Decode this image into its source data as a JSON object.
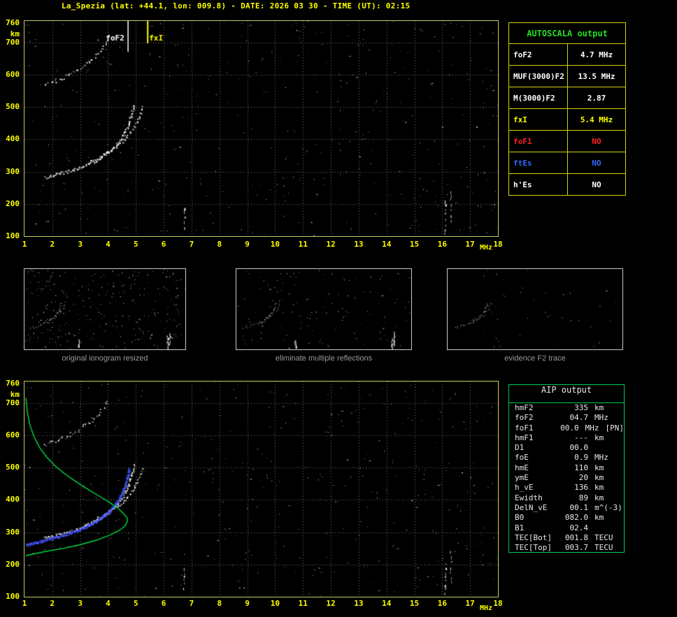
{
  "header": {
    "title": "La_Spezia (lat: +44.1, lon: 009.8) - DATE: 2026 03 30 - TIME (UT): 02:15"
  },
  "colors": {
    "background": "#000000",
    "title": "#ffff00",
    "axis": "#ffff00",
    "plot_border": "#c8c860",
    "grid": "#7a7a7a",
    "echo": "#ffffff",
    "profile_green": "#00dd44",
    "model_blue": "#4455ff",
    "autoscala_border": "#d4d400",
    "autoscala_title": "#22dd22",
    "aip_border": "#00cc55",
    "aip_text": "#e8e8e8",
    "caption": "#9a9a9a"
  },
  "autoscala_table": {
    "title": "AUTOSCALA output",
    "rows": [
      {
        "label": "foF2",
        "value": "4.7 MHz",
        "color": "#ffffff"
      },
      {
        "label": "MUF(3000)F2",
        "value": "13.5 MHz",
        "color": "#ffffff"
      },
      {
        "label": "M(3000)F2",
        "value": "2.87",
        "color": "#ffffff"
      },
      {
        "label": "fxI",
        "value": "5.4 MHz",
        "color": "#ffff00"
      },
      {
        "label": "foF1",
        "value": "NO",
        "color": "#ff2222"
      },
      {
        "label": "ftEs",
        "value": "NO",
        "color": "#3366ff"
      },
      {
        "label": "h'Es",
        "value": "NO",
        "color": "#ffffff"
      }
    ]
  },
  "aip_table": {
    "title": "AIP output",
    "rows": [
      {
        "label": "hmF2",
        "value": "335",
        "unit": "km",
        "note": ""
      },
      {
        "label": "foF2",
        "value": "04.7",
        "unit": "MHz",
        "note": ""
      },
      {
        "label": "foF1",
        "value": "00.0",
        "unit": "MHz",
        "note": "[PN]"
      },
      {
        "label": "hmF1",
        "value": "---",
        "unit": "km",
        "note": ""
      },
      {
        "label": "D1",
        "value": "00.0",
        "unit": "",
        "note": ""
      },
      {
        "label": "foE",
        "value": "0.9",
        "unit": "MHz",
        "note": ""
      },
      {
        "label": "hmE",
        "value": "110",
        "unit": "km",
        "note": ""
      },
      {
        "label": "ymE",
        "value": "20",
        "unit": "km",
        "note": ""
      },
      {
        "label": "h_vE",
        "value": "136",
        "unit": "km",
        "note": ""
      },
      {
        "label": "Ewidth",
        "value": "89",
        "unit": "km",
        "note": ""
      },
      {
        "label": "DelN_vE",
        "value": "00.1",
        "unit": "m^(-3)",
        "note": ""
      },
      {
        "label": "B0",
        "value": "082.0",
        "unit": "km",
        "note": ""
      },
      {
        "label": "B1",
        "value": "02.4",
        "unit": "",
        "note": ""
      },
      {
        "label": "TEC[Bot]",
        "value": "001.8",
        "unit": "TECU",
        "note": ""
      },
      {
        "label": "TEC[Top]",
        "value": "003.7",
        "unit": "TECU",
        "note": ""
      }
    ]
  },
  "thumbnails": [
    {
      "caption": "original ionogram resized"
    },
    {
      "caption": "eliminate multiple reflections"
    },
    {
      "caption": "evidence F2 trace"
    }
  ],
  "chart_data": {
    "type": "scatter",
    "title": "Ionogram La_Spezia 2026-03-30 02:15 UT",
    "x_axis": {
      "label": "MHz",
      "range": [
        1,
        18
      ],
      "ticks": [
        1,
        2,
        3,
        4,
        5,
        6,
        7,
        8,
        9,
        10,
        11,
        12,
        13,
        14,
        15,
        16,
        17,
        18
      ]
    },
    "y_axis": {
      "label": "km",
      "range": [
        100,
        766
      ],
      "ticks": [
        760,
        700,
        600,
        500,
        400,
        300,
        200,
        100
      ],
      "grid_ticks": [
        200,
        300,
        400,
        500,
        600,
        700
      ]
    },
    "grid": true,
    "annotations": [
      {
        "id": "foF2",
        "label": "foF2",
        "mhz": 4.7,
        "color": "#ffffff",
        "line_height": 44,
        "label_dx": -31,
        "label_dy": 28
      },
      {
        "id": "fxI",
        "label": "fxI",
        "mhz": 5.4,
        "color": "#ffff00",
        "line_height": 32,
        "label_dx": 3,
        "label_dy": 28
      }
    ],
    "traces": {
      "o_trace": [
        [
          1.7,
          283
        ],
        [
          2.0,
          289
        ],
        [
          2.3,
          296
        ],
        [
          2.6,
          303
        ],
        [
          2.9,
          311
        ],
        [
          3.2,
          321
        ],
        [
          3.5,
          333
        ],
        [
          3.8,
          348
        ],
        [
          4.1,
          368
        ],
        [
          4.35,
          390
        ],
        [
          4.55,
          415
        ],
        [
          4.7,
          443
        ],
        [
          4.8,
          470
        ],
        [
          4.88,
          495
        ],
        [
          4.92,
          510
        ]
      ],
      "x_trace": [
        [
          3.3,
          330
        ],
        [
          3.6,
          342
        ],
        [
          3.9,
          356
        ],
        [
          4.2,
          373
        ],
        [
          4.5,
          394
        ],
        [
          4.75,
          418
        ],
        [
          4.95,
          443
        ],
        [
          5.1,
          468
        ],
        [
          5.2,
          490
        ],
        [
          5.25,
          507
        ]
      ],
      "second_hop": [
        [
          1.7,
          572
        ],
        [
          2.0,
          580
        ],
        [
          2.3,
          590
        ],
        [
          2.6,
          602
        ],
        [
          2.9,
          616
        ],
        [
          3.2,
          634
        ],
        [
          3.5,
          656
        ],
        [
          3.8,
          684
        ],
        [
          4.0,
          712
        ]
      ],
      "model_trace_blue": [
        [
          1.05,
          262
        ],
        [
          1.4,
          269
        ],
        [
          1.8,
          277
        ],
        [
          2.2,
          286
        ],
        [
          2.6,
          297
        ],
        [
          3.0,
          310
        ],
        [
          3.4,
          326
        ],
        [
          3.7,
          342
        ],
        [
          4.0,
          362
        ],
        [
          4.25,
          386
        ],
        [
          4.45,
          414
        ],
        [
          4.6,
          444
        ],
        [
          4.7,
          475
        ],
        [
          4.75,
          500
        ]
      ],
      "density_profile_green": [
        [
          1.05,
          716
        ],
        [
          1.1,
          672
        ],
        [
          1.2,
          630
        ],
        [
          1.35,
          594
        ],
        [
          1.55,
          561
        ],
        [
          1.8,
          532
        ],
        [
          2.1,
          505
        ],
        [
          2.45,
          480
        ],
        [
          2.85,
          456
        ],
        [
          3.25,
          434
        ],
        [
          3.65,
          413
        ],
        [
          4.05,
          392
        ],
        [
          4.35,
          374
        ],
        [
          4.55,
          358
        ],
        [
          4.68,
          345
        ],
        [
          4.7,
          335
        ],
        [
          4.62,
          320
        ],
        [
          4.42,
          306
        ],
        [
          4.05,
          290
        ],
        [
          3.55,
          274
        ],
        [
          2.95,
          260
        ],
        [
          2.35,
          249
        ],
        [
          1.75,
          240
        ],
        [
          1.3,
          232
        ],
        [
          1.05,
          227
        ]
      ]
    },
    "interference": [
      {
        "mhz": 6.72,
        "km": [
          128,
          192
        ]
      },
      {
        "mhz": 16.1,
        "km": [
          112,
          215
        ]
      },
      {
        "mhz": 16.3,
        "km": [
          150,
          250
        ]
      }
    ],
    "noise": {
      "seed": 20260330,
      "main_count": 430,
      "thumb_counts": [
        300,
        130,
        40
      ]
    }
  }
}
